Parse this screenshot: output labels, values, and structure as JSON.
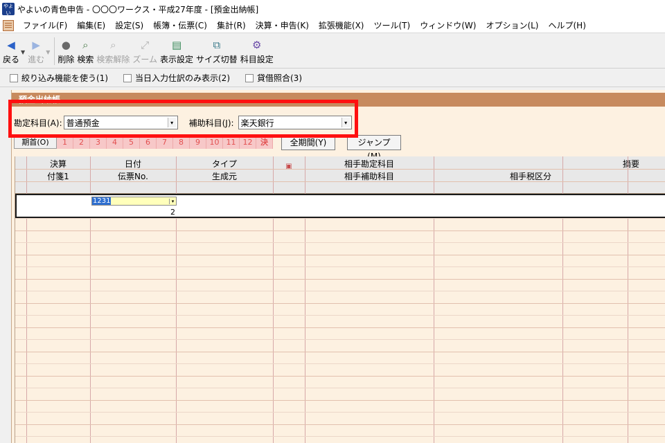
{
  "window": {
    "title": "やよいの青色申告 - 〇〇〇ワークス・平成27年度 - [預金出納帳]",
    "logo_text": "やよい"
  },
  "menu": [
    "ファイル(F)",
    "編集(E)",
    "設定(S)",
    "帳簿・伝票(C)",
    "集計(R)",
    "決算・申告(K)",
    "拡張機能(X)",
    "ツール(T)",
    "ウィンドウ(W)",
    "オプション(L)",
    "ヘルプ(H)"
  ],
  "toolbar": {
    "back": "戻る",
    "forward": "進む",
    "delete": "削除",
    "search": "検索",
    "clear_search": "検索解除",
    "zoom": "ズーム",
    "display_settings": "表示設定",
    "size_toggle": "サイズ切替",
    "account_settings": "科目設定"
  },
  "filters": {
    "narrow": "絞り込み機能を使う(1)",
    "today_only": "当日入力仕訳のみ表示(2)",
    "balance_check": "貸借照合(3)"
  },
  "panel": {
    "title": "預金出納帳",
    "account_label": "勘定科目(A):",
    "account_value": "普通預金",
    "sub_account_label": "補助科目(J):",
    "sub_account_value": "楽天銀行",
    "period_first": "期首(O)",
    "months": [
      "1",
      "2",
      "3",
      "4",
      "5",
      "6",
      "7",
      "8",
      "9",
      "10",
      "11",
      "12",
      "決"
    ],
    "all_period": "全期間(Y)",
    "jump": "ジャンプ(M)"
  },
  "grid": {
    "headers_top": [
      "決算",
      "日付",
      "タイプ",
      "相手勘定科目",
      "摘要"
    ],
    "headers_bottom": [
      "付箋1",
      "伝票No.",
      "生成元",
      "相手補助科目",
      "相手税区分"
    ],
    "active_row": {
      "date": "1231",
      "voucher_no": "2"
    }
  }
}
